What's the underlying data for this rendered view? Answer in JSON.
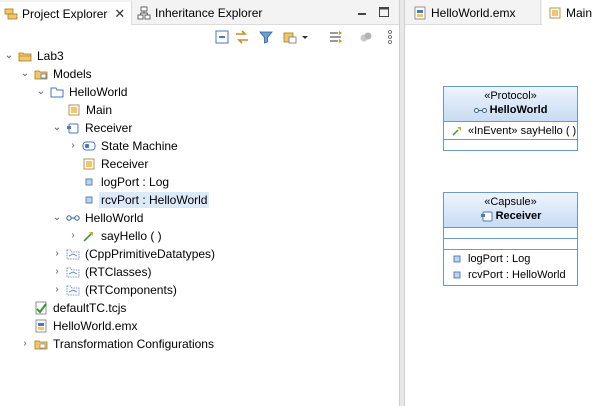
{
  "left_tabs": [
    {
      "label": "Project Explorer",
      "icon": "project-explorer-icon",
      "active": true,
      "close": "✕"
    },
    {
      "label": "Inheritance Explorer",
      "icon": "inheritance-explorer-icon",
      "active": false
    }
  ],
  "tree": [
    {
      "label": "Lab3",
      "icon": "project-folder-icon",
      "level": 0,
      "twisty": "expanded"
    },
    {
      "label": "Models",
      "icon": "models-folder-icon",
      "level": 1,
      "twisty": "expanded"
    },
    {
      "label": "HelloWorld",
      "icon": "package-folder-icon",
      "level": 2,
      "twisty": "expanded"
    },
    {
      "label": "Main",
      "icon": "diagram-icon",
      "level": 3,
      "twisty": "none"
    },
    {
      "label": "Receiver",
      "icon": "capsule-icon",
      "level": 3,
      "twisty": "expanded"
    },
    {
      "label": "State Machine",
      "icon": "state-machine-icon",
      "level": 4,
      "twisty": "collapsed"
    },
    {
      "label": "Receiver",
      "icon": "diagram-icon",
      "level": 4,
      "twisty": "none"
    },
    {
      "label": "logPort : Log",
      "icon": "port-icon",
      "level": 4,
      "twisty": "none"
    },
    {
      "label": "rcvPort : HelloWorld",
      "icon": "port-icon",
      "level": 4,
      "twisty": "none",
      "selected": true
    },
    {
      "label": "HelloWorld",
      "icon": "protocol-icon",
      "level": 3,
      "twisty": "expanded"
    },
    {
      "label": "sayHello ( )",
      "icon": "in-event-icon",
      "level": 4,
      "twisty": "collapsed"
    },
    {
      "label": "(CppPrimitiveDatatypes)",
      "icon": "library-icon",
      "level": 3,
      "twisty": "collapsed"
    },
    {
      "label": "(RTClasses)",
      "icon": "library-icon",
      "level": 3,
      "twisty": "collapsed"
    },
    {
      "label": "(RTComponents)",
      "icon": "library-icon",
      "level": 3,
      "twisty": "collapsed"
    },
    {
      "label": "defaultTC.tcjs",
      "icon": "tc-file-icon",
      "level": 1,
      "twisty": "none"
    },
    {
      "label": "HelloWorld.emx",
      "icon": "emx-file-icon",
      "level": 1,
      "twisty": "none"
    },
    {
      "label": "Transformation Configurations",
      "icon": "tc-folder-icon",
      "level": 1,
      "twisty": "collapsed"
    }
  ],
  "right_tabs": [
    {
      "label": "HelloWorld.emx",
      "icon": "emx-file-icon"
    },
    {
      "label": "Main",
      "icon": "diagram-icon"
    }
  ],
  "protocol_box": {
    "stereotype": "«Protocol»",
    "name": "HelloWorld",
    "events": [
      {
        "label": "«InEvent» sayHello ( )"
      }
    ]
  },
  "capsule_box": {
    "stereotype": "«Capsule»",
    "name": "Receiver",
    "ports": [
      {
        "label": "logPort : Log"
      },
      {
        "label": "rcvPort : HelloWorld"
      }
    ]
  },
  "colors": {
    "accent": "#6d97c6",
    "selection": "#dbe9f8",
    "header_gradient_top": "#eef4fc",
    "header_gradient_bottom": "#c8dcf3"
  }
}
